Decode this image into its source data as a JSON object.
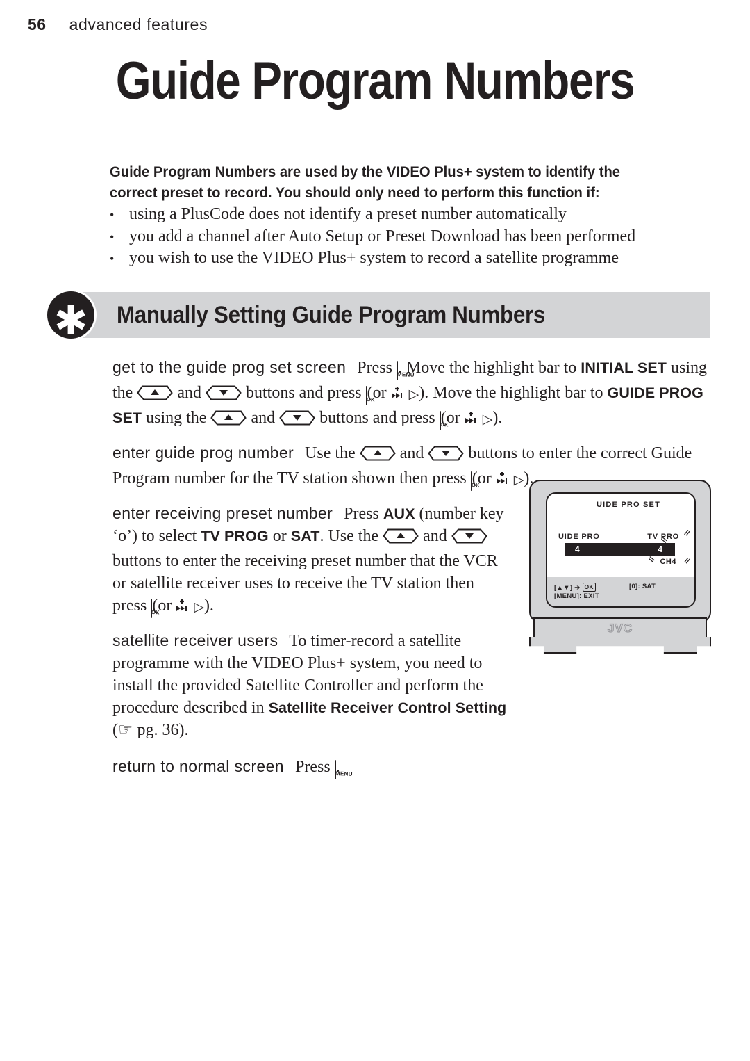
{
  "runhead": {
    "page_number": "56",
    "section": "advanced features"
  },
  "page": {
    "title": "Guide Program Numbers"
  },
  "lead": {
    "text": "Guide Program Numbers are used by the VIDEO Plus+ system to identify the correct preset to record. You should only need to perform this function if:"
  },
  "bullets": [
    {
      "marker": "•",
      "text": "using a PlusCode does not identify a preset number automatically"
    },
    {
      "marker": "•",
      "text": "you add a channel after Auto Setup or Preset Download has been performed"
    },
    {
      "marker": "•",
      "text": "you wish to use the VIDEO Plus+ system to record a satellite programme"
    }
  ],
  "section_header": {
    "badge_glyph": "✱",
    "title": "Manually Setting Guide Program Numbers"
  },
  "steps": {
    "step1": {
      "label": "get to the guide prog set screen",
      "t1": "Press",
      "t2": ". Move the highlight bar to",
      "t3": "INITIAL SET",
      "t4": "using the",
      "t5": "and",
      "t6": "buttons and press",
      "t7": "(or",
      "t8": "). Move the highlight bar to",
      "t9": "GUIDE PROG SET",
      "t10": "using the",
      "t11": "and",
      "t12": "buttons and press",
      "t13": "(or",
      "t14": ")."
    },
    "step2": {
      "label": "enter guide prog number",
      "t1": "Use the",
      "t2": "and",
      "t3": "buttons to enter the correct Guide Program number for the TV station shown then press",
      "t4": "(or",
      "t5": ")."
    },
    "step3": {
      "label": "enter receiving preset number",
      "t1": "Press",
      "t2": "AUX",
      "t3": "(number key ‘o’) to select",
      "t4": "TV PROG",
      "t5": "or",
      "t6": "SAT",
      "t7": ". Use the",
      "t8": "and",
      "t9": "buttons to enter the receiving preset number that the VCR or satellite receiver uses to receive the TV station then press",
      "t10": "(or",
      "t11": ")."
    },
    "step4": {
      "label": "satellite receiver users",
      "t1": "To timer-record a satellite programme with the VIDEO Plus+ system, you need to install the provided Satellite Controller and perform the procedure described in",
      "t2": "Satellite Receiver Control Setting",
      "t3": "(",
      "hand": "☞",
      "t4": "pg. 36).",
      "page_ref": "36"
    },
    "step5": {
      "label": "return to normal screen",
      "t1": "Press",
      "t2": "."
    }
  },
  "keys": {
    "menu_label": "MENU",
    "ok_label": "OK",
    "skip_glyph": "skip-forward-icon",
    "triangle_right": "▷"
  },
  "tv": {
    "osd_title": "UIDE PRO  SET",
    "label_left": "UIDE PRO",
    "label_right": "TV PRO",
    "value_left": "4",
    "value_right": "4",
    "channel": "CH4",
    "footer_left_1": "[▲▼] ➔",
    "footer_ok": "OK",
    "footer_left_2": "[MENU]: EXIT",
    "footer_right": "[0]: SAT",
    "brand": "JVC"
  },
  "colors": {
    "ink": "#231f20",
    "bar_gray": "#d3d4d6",
    "white": "#ffffff"
  }
}
